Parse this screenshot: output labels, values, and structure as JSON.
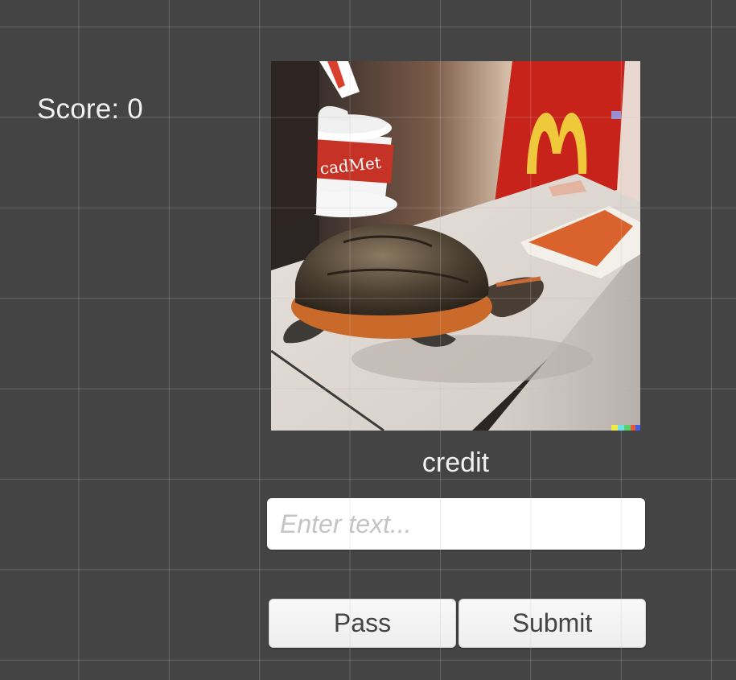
{
  "hud": {
    "score_label": "Score: 0"
  },
  "challenge": {
    "image_description": "Turtle on a fast food restaurant counter with a red and white drink cup on its back",
    "prompt_word": "credit"
  },
  "answer": {
    "placeholder": "Enter text...",
    "value": ""
  },
  "buttons": {
    "pass_label": "Pass",
    "submit_label": "Submit"
  },
  "colors": {
    "background": "#444444",
    "text": "#f2f2f2",
    "button_face": "#f4f4f4",
    "logo_red": "#c8231b",
    "logo_gold": "#f0c93a"
  }
}
